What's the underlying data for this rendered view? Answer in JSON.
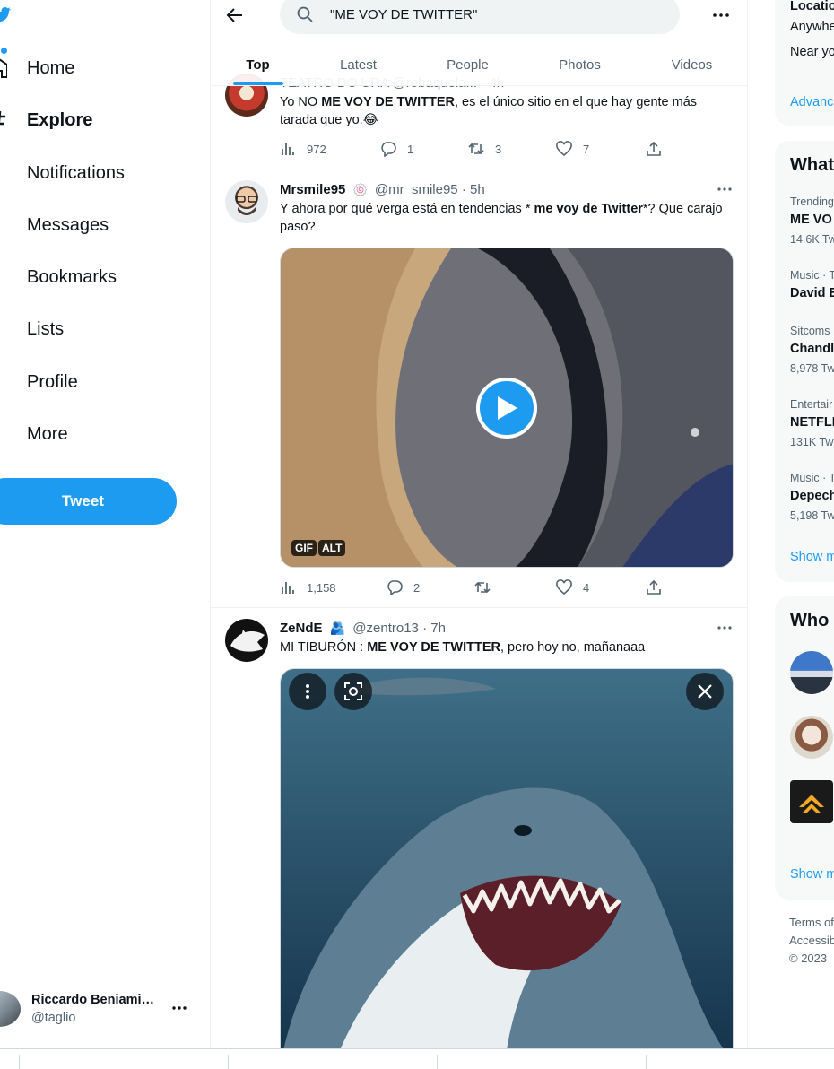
{
  "nav": {
    "items": [
      {
        "label": "Home",
        "icon": "home-icon"
      },
      {
        "label": "Explore",
        "icon": "hashtag-icon"
      },
      {
        "label": "Notifications",
        "icon": "bell-icon"
      },
      {
        "label": "Messages",
        "icon": "mail-icon"
      },
      {
        "label": "Bookmarks",
        "icon": "bookmark-icon"
      },
      {
        "label": "Lists",
        "icon": "list-icon"
      },
      {
        "label": "Profile",
        "icon": "person-icon"
      },
      {
        "label": "More",
        "icon": "more-circle-icon"
      }
    ],
    "tweet_button": "Tweet",
    "account": {
      "name": "Riccardo Beniami…",
      "handle": "@taglio"
    }
  },
  "search": {
    "query": "\"ME VOY DE TWITTER\""
  },
  "tabs": [
    {
      "label": "Top",
      "active": true
    },
    {
      "label": "Latest",
      "active": false
    },
    {
      "label": "People",
      "active": false
    },
    {
      "label": "Photos",
      "active": false
    },
    {
      "label": "Videos",
      "active": false
    }
  ],
  "tweets": [
    {
      "header_partial": "TEATRO DO URA @robaquela... · 4h",
      "text_pre": "Yo NO ",
      "text_bold": "ME VOY DE TWITTER",
      "text_post": ", es el único sitio en el que hay gente más tarada que yo.😂",
      "views": "972",
      "replies": "1",
      "retweets": "3",
      "likes": "7"
    },
    {
      "name": "Mrsmile95",
      "badge_emoji": "🍥",
      "handle": "@mr_smile95",
      "time": "· 5h",
      "text_pre": "Y ahora por qué verga está en tendencias * ",
      "text_bold": "me voy de Twitter",
      "text_post": "*? Que carajo paso?",
      "media_badges": [
        "GIF",
        "ALT"
      ],
      "views": "1,158",
      "replies": "2",
      "retweets": "",
      "likes": "4"
    },
    {
      "name": "ZeNdE",
      "badge_emoji": "🫂",
      "handle": "@zentro13",
      "time": "· 7h",
      "text_pre": "MI TIBURÓN : ",
      "text_bold": "ME VOY DE TWITTER",
      "text_post": ", pero hoy no, mañanaaa"
    }
  ],
  "right": {
    "search_filters": {
      "title": "Locatio",
      "opt1": "Anywhe",
      "opt2": "Near yo",
      "advanced": "Advanc"
    },
    "trends_title": "What",
    "trends": [
      {
        "context": "Trending",
        "name": "ME VO",
        "count": "14.6K Tw"
      },
      {
        "context": "Music · T",
        "name": "David E",
        "count": ""
      },
      {
        "context": "Sitcoms",
        "name": "Chandl",
        "count": "8,978 Tw"
      },
      {
        "context": "Entertair",
        "name": "NETFLI",
        "count": "131K Twe"
      },
      {
        "context": "Music · T",
        "name": "Depech",
        "count": "5,198 Tw"
      }
    ],
    "trends_show_more": "Show m",
    "wtf_title": "Who",
    "wtf_show_more": "Show m",
    "footer": [
      "Terms of",
      "Accessib",
      "© 2023"
    ]
  },
  "colors": {
    "accent": "#1d9bf0",
    "text": "#0f1419",
    "muted": "#536471",
    "card": "#f7f9f9"
  }
}
